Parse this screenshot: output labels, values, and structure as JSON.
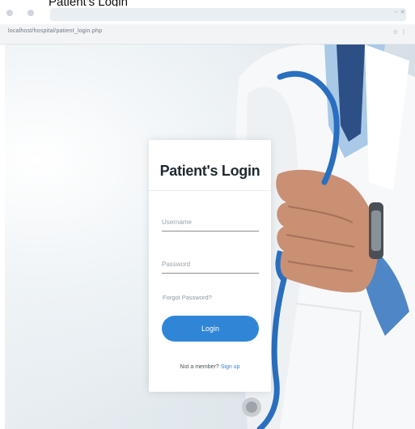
{
  "top_caption": "Patient's Login",
  "browser": {
    "tab_dots": [
      "",
      ""
    ],
    "url": "localhost/hospital/patient_login.php",
    "window_controls": "–  ×",
    "address_icons": "☆ ⋮"
  },
  "login": {
    "title": "Patient's Login",
    "username_placeholder": "Username",
    "password_placeholder": "Password",
    "forgot_password": "Forgot Password?",
    "login_button": "Login",
    "not_member": "Not a member?",
    "signup": "Sign up"
  },
  "colors": {
    "accent": "#2f86d6",
    "card_bg": "#ffffff",
    "title": "#1f2a33"
  }
}
